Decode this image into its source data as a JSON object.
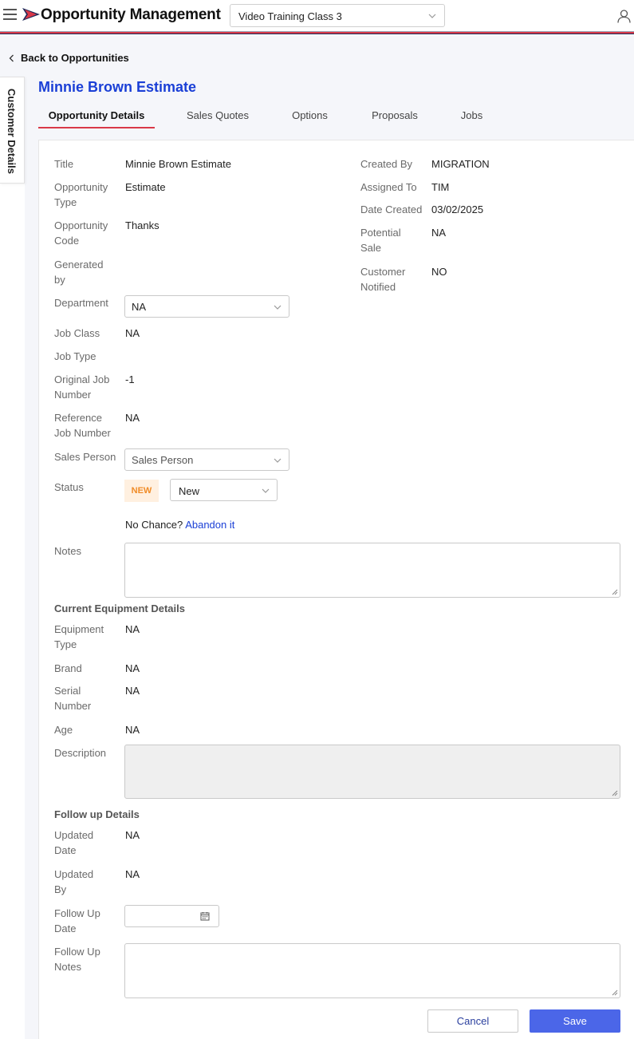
{
  "header": {
    "app_title": "Opportunity Management",
    "company": "Video Training Class 3",
    "brand_colors": {
      "accent": "#d93848",
      "navy": "#1e2a5a",
      "link": "#1a3fd6"
    }
  },
  "nav": {
    "back_label": "Back to Opportunities"
  },
  "side_tab": {
    "label": "Customer Details"
  },
  "opportunity": {
    "name": "Minnie Brown Estimate"
  },
  "tabs": [
    {
      "label": "Opportunity Details",
      "active": true
    },
    {
      "label": "Sales Quotes"
    },
    {
      "label": "Options"
    },
    {
      "label": "Proposals"
    },
    {
      "label": "Jobs"
    }
  ],
  "details": {
    "title": {
      "label": "Title",
      "value": "Minnie Brown Estimate"
    },
    "opp_type": {
      "label": "Opportunity Type",
      "value": "Estimate"
    },
    "opp_code": {
      "label": "Opportunity Code",
      "value": "Thanks"
    },
    "generated_by": {
      "label": "Generated by",
      "value": ""
    },
    "department": {
      "label": "Department",
      "value": "NA"
    },
    "job_class": {
      "label": "Job Class",
      "value": "NA"
    },
    "job_type": {
      "label": "Job Type",
      "value": ""
    },
    "original_job": {
      "label": "Original Job Number",
      "value": "-1"
    },
    "reference_job": {
      "label": "Reference Job Number",
      "value": "NA"
    },
    "sales_person": {
      "label": "Sales Person",
      "placeholder": "Sales Person"
    },
    "status": {
      "label": "Status",
      "badge": "NEW",
      "value": "New"
    },
    "no_chance": {
      "text": "No Chance?",
      "link": "Abandon it"
    },
    "notes": {
      "label": "Notes",
      "value": ""
    },
    "created_by": {
      "label": "Created By",
      "value": "MIGRATION"
    },
    "assigned_to": {
      "label": "Assigned To",
      "value": "TIM"
    },
    "date_created": {
      "label": "Date Created",
      "value": "03/02/2025"
    },
    "potential_sale": {
      "label": "Potential Sale",
      "value": "NA"
    },
    "customer_notified": {
      "label": "Customer Notified",
      "value": "NO"
    }
  },
  "equipment": {
    "heading": "Current Equipment Details",
    "type": {
      "label": "Equipment Type",
      "value": "NA"
    },
    "brand": {
      "label": "Brand",
      "value": "NA"
    },
    "serial": {
      "label": "Serial Number",
      "value": "NA"
    },
    "age": {
      "label": "Age",
      "value": "NA"
    },
    "description": {
      "label": "Description",
      "value": ""
    }
  },
  "followup": {
    "heading": "Follow up Details",
    "updated_date": {
      "label": "Updated Date",
      "value": "NA"
    },
    "updated_by": {
      "label": "Updated By",
      "value": "NA"
    },
    "followup_date": {
      "label": "Follow Up Date",
      "value": ""
    },
    "followup_notes": {
      "label": "Follow Up Notes",
      "value": ""
    }
  },
  "actions": {
    "cancel": "Cancel",
    "save": "Save"
  }
}
